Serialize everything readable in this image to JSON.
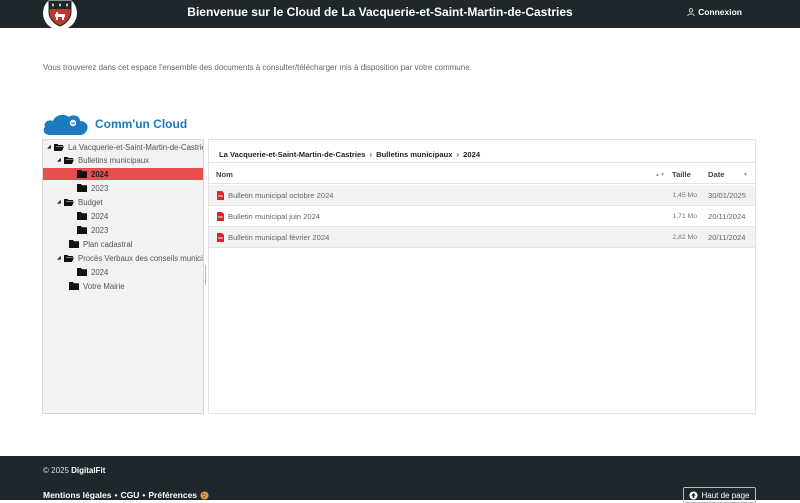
{
  "header": {
    "title": "Bienvenue sur le Cloud de La Vacquerie-et-Saint-Martin-de-Castries",
    "login_label": "Connexion"
  },
  "intro_text": "Vous trouverez dans cet espace l'ensemble des documents à consulter/télécharger mis à disposition par votre commune.",
  "brand": {
    "name": "Comm'un Cloud",
    "color": "#1b7bbf"
  },
  "tree": {
    "items": [
      {
        "label": "La Vacquerie-et-Saint-Martin-de-Castries",
        "icon": "folder-open-icon",
        "expanded": true
      },
      {
        "label": "Bulletins municipaux",
        "icon": "folder-open-icon",
        "expanded": true
      },
      {
        "label": "2024",
        "icon": "folder-icon",
        "selected": true
      },
      {
        "label": "2023",
        "icon": "folder-icon"
      },
      {
        "label": "Budget",
        "icon": "folder-open-icon",
        "expanded": true
      },
      {
        "label": "2024",
        "icon": "folder-icon"
      },
      {
        "label": "2023",
        "icon": "folder-icon"
      },
      {
        "label": "Plan cadastral",
        "icon": "folder-icon"
      },
      {
        "label": "Procès Verbaux des conseils municipaux",
        "icon": "folder-open-icon",
        "expanded": true
      },
      {
        "label": "2024",
        "icon": "folder-icon"
      },
      {
        "label": "Votre Mairie",
        "icon": "folder-icon"
      }
    ],
    "selected_color": "#e94e4e"
  },
  "breadcrumb": [
    "La Vacquerie-et-Saint-Martin-de-Castries",
    "Bulletins municipaux",
    "2024"
  ],
  "table": {
    "columns": {
      "name": "Nom",
      "size": "Taille",
      "date": "Date"
    },
    "rows": [
      {
        "name": "Bulletin municipal octobre 2024",
        "size": "1,45 Mo",
        "date": "30/01/2025",
        "icon": "pdf-icon"
      },
      {
        "name": "Bulletin municipal juin 2024",
        "size": "1,71 Mo",
        "date": "20/11/2024",
        "icon": "pdf-icon"
      },
      {
        "name": "Bulletin municipal février 2024",
        "size": "2,82 Mo",
        "date": "20/11/2024",
        "icon": "pdf-icon"
      }
    ],
    "pdf_color": "#d9252b"
  },
  "footer": {
    "copyright": "© 2025",
    "company": "DigitalFit",
    "links": [
      "Mentions légales",
      "CGU",
      "Préférences"
    ],
    "separator": "•",
    "back_to_top": "Haut de page"
  },
  "colors": {
    "dark": "#1e272c"
  }
}
